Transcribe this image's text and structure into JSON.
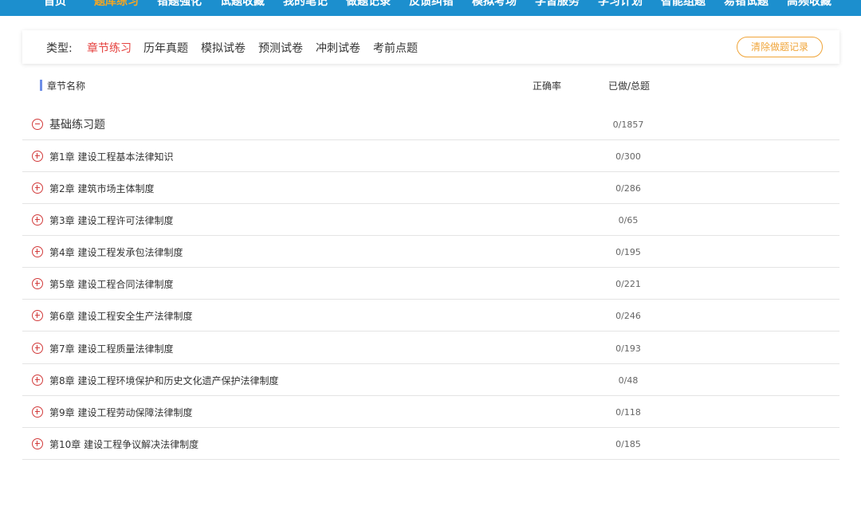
{
  "nav": {
    "items": [
      "首页",
      "题库练习",
      "错题强化",
      "试题收藏",
      "我的笔记",
      "做题记录",
      "反馈纠错",
      "模拟考场",
      "学習服务",
      "学习计划",
      "智能组题",
      "易错试题",
      "高频收藏"
    ],
    "active_index": 1,
    "bg_color": "#1c8fce",
    "active_color": "#f5a623"
  },
  "filter": {
    "type_label": "类型:",
    "options": [
      "章节练习",
      "历年真题",
      "模拟试卷",
      "预测试卷",
      "冲刺试卷",
      "考前点题"
    ],
    "active_index": 0,
    "clear_button": "清除做题记录",
    "active_color": "#e64340"
  },
  "table": {
    "headers": {
      "name": "章节名称",
      "rate": "正确率",
      "done_total": "已做/总题"
    },
    "group": {
      "name": "基础练习题",
      "count": "0/1857",
      "expanded": true
    },
    "rows": [
      {
        "name": "第1章  建设工程基本法律知识",
        "count": "0/300"
      },
      {
        "name": "第2章  建筑市场主体制度",
        "count": "0/286"
      },
      {
        "name": "第3章  建设工程许可法律制度",
        "count": "0/65"
      },
      {
        "name": "第4章  建设工程发承包法律制度",
        "count": "0/195"
      },
      {
        "name": "第5章  建设工程合同法律制度",
        "count": "0/221"
      },
      {
        "name": "第6章  建设工程安全生产法律制度",
        "count": "0/246"
      },
      {
        "name": "第7章  建设工程质量法律制度",
        "count": "0/193"
      },
      {
        "name": "第8章  建设工程环境保护和历史文化遗产保护法律制度",
        "count": "0/48"
      },
      {
        "name": "第9章  建设工程劳动保障法律制度",
        "count": "0/118"
      },
      {
        "name": "第10章  建设工程争议解决法律制度",
        "count": "0/185"
      }
    ]
  },
  "icons": {
    "collapse": "minus-circle-icon",
    "expand": "plus-circle-icon"
  }
}
